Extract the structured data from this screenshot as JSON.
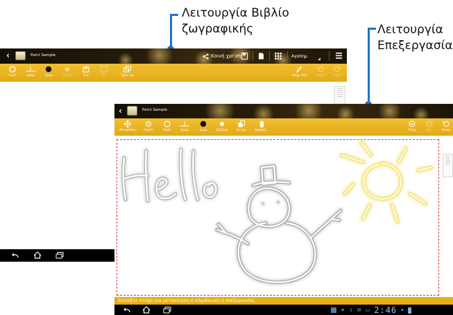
{
  "callouts": {
    "book_mode": [
      "Λειτουργία Βιβλίο",
      "ζωγραφικής"
    ],
    "edit_mode": [
      "Λειτουργία",
      "Επεξεργασία"
    ]
  },
  "top_window": {
    "app_title": "Paint Sample",
    "share_label": "Κοινή χρήση",
    "dropdown_value": "Αγαπημ",
    "tools": [
      {
        "name": "Πινέλ",
        "icon": "brush-circle-icon",
        "enabled": true
      },
      {
        "name": "Χρώμ",
        "icon": "stroke-width-icon",
        "enabled": true
      },
      {
        "name": "Χρώμ",
        "icon": "color-dot-icon",
        "enabled": true
      },
      {
        "name": "Σβήσιμ",
        "icon": "eraser-icon",
        "enabled": false
      },
      {
        "name": "Εισ",
        "icon": "insert-icon",
        "enabled": true
      },
      {
        "name": "Επικ",
        "icon": "paste-icon",
        "enabled": false
      },
      {
        "name": "Τρόπ. Ομ",
        "icon": "layers-icon",
        "enabled": true
      },
      {
        "name": "Αποχ. επεξ",
        "icon": "exit-edit-icon",
        "enabled": true
      },
      {
        "name": "Αναίρ",
        "icon": "undo-icon",
        "enabled": false
      },
      {
        "name": "Ακύρ",
        "icon": "redo-icon",
        "enabled": false
      }
    ]
  },
  "main_window": {
    "app_title": "Paint Sample",
    "tools": [
      {
        "name": "Μετακ/Κλιμ",
        "icon": "move-icon",
        "enabled": true
      },
      {
        "name": "Περιστ",
        "icon": "rotate-icon",
        "enabled": true
      },
      {
        "name": "Πινέλ",
        "icon": "brush-circle-icon",
        "enabled": true
      },
      {
        "name": "Χρώμ",
        "icon": "stroke-width-icon",
        "enabled": true
      },
      {
        "name": "Χρώμ",
        "icon": "color-dot-icon",
        "enabled": true
      },
      {
        "name": "Εξάλειψ",
        "icon": "erase-dot-icon",
        "enabled": true
      },
      {
        "name": "Αντιγρ",
        "icon": "copy-icon",
        "enabled": true
      },
      {
        "name": "Διαγρ/Ε...",
        "icon": "delete-icon",
        "enabled": true
      },
      {
        "name": "Τέλος",
        "icon": "done-icon",
        "enabled": true
      },
      {
        "name": "Επαν",
        "icon": "redo-icon",
        "enabled": false
      },
      {
        "name": "Αναίρ",
        "icon": "undo-icon",
        "enabled": true
      }
    ],
    "status_message": "Επιλέξτε στόχο για μετακίνηση ή κλιμάκωση ή επεξεργασία.",
    "clock": "2:46",
    "canvas_text": "Hello"
  },
  "colors": {
    "accent_yellow": "#e9b11c",
    "callout_blue": "#1a73c9",
    "selection_red": "#dd3333"
  }
}
